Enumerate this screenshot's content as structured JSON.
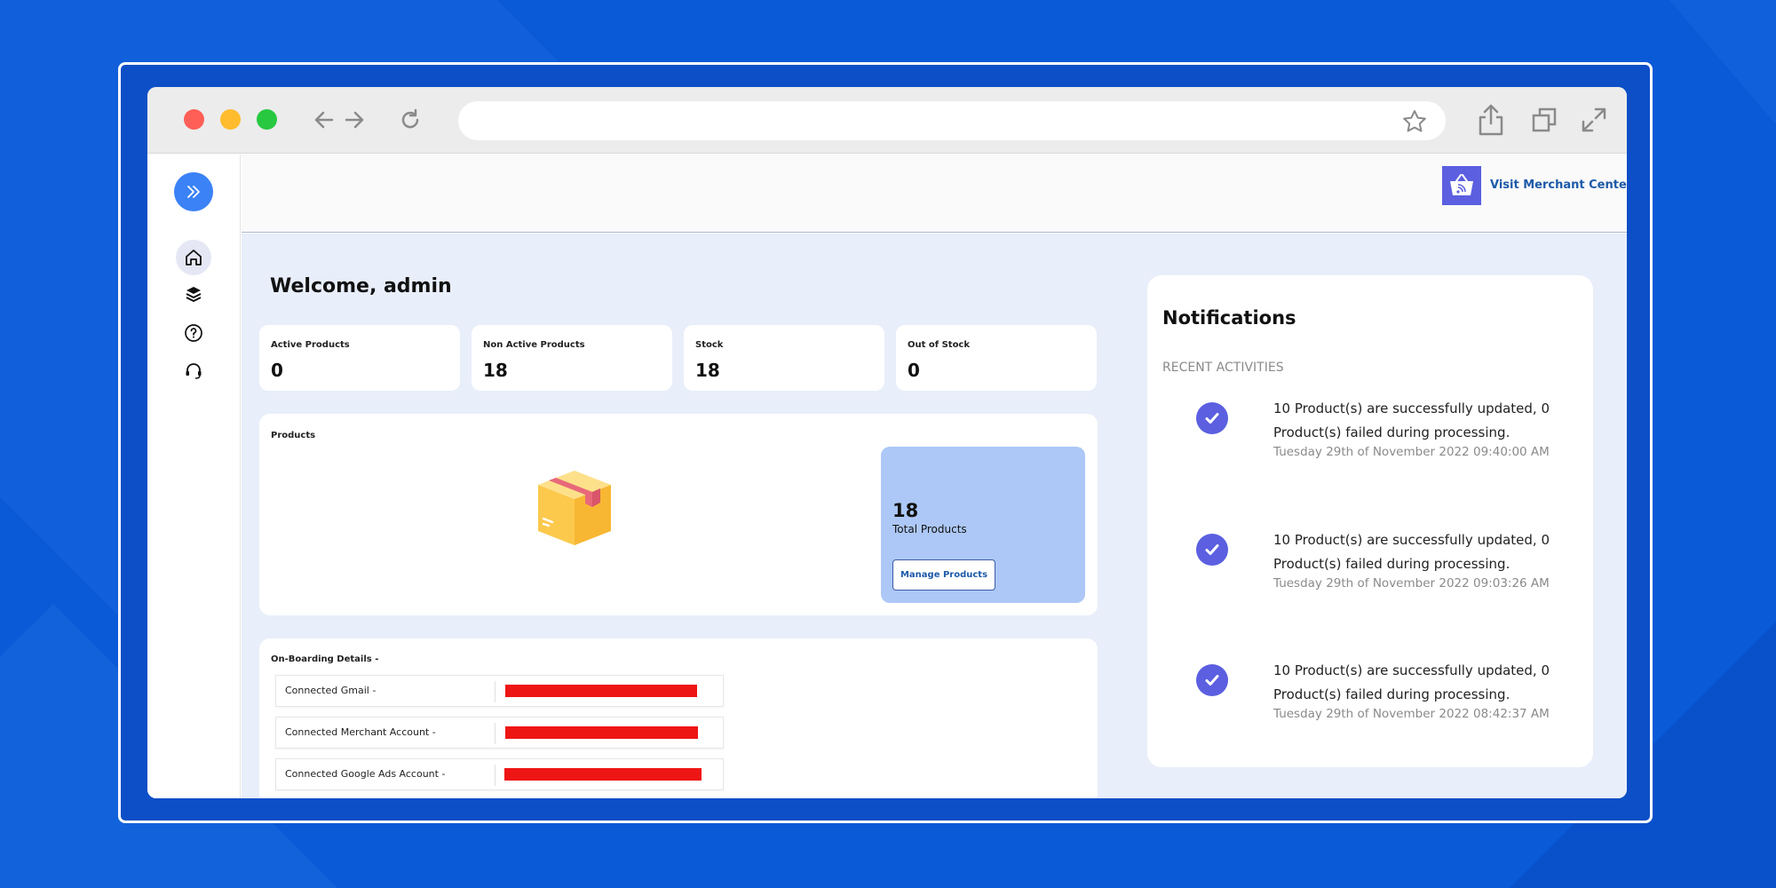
{
  "background": {
    "color": "#0a5ad8"
  },
  "browser": {
    "buttons": {
      "close": "#ff5f57",
      "minimize": "#febc2e",
      "maximize": "#28c840"
    },
    "url": "",
    "icons": [
      "back-arrow-icon",
      "forward-arrow-icon",
      "reload-icon",
      "star-icon",
      "share-icon",
      "tabs-icon",
      "fullscreen-icon"
    ]
  },
  "header": {
    "merchant_link": "Visit Merchant Center",
    "accent": "#5b5fe0"
  },
  "sidebar": {
    "items": [
      {
        "icon": "home-icon",
        "active": true
      },
      {
        "icon": "box-stack-icon",
        "active": false
      },
      {
        "icon": "help-icon",
        "active": false
      },
      {
        "icon": "headset-icon",
        "active": false
      }
    ]
  },
  "main": {
    "welcome": "Welcome, admin",
    "stats": [
      {
        "label": "Active Products",
        "value": "0"
      },
      {
        "label": "Non Active Products",
        "value": "18"
      },
      {
        "label": "Stock",
        "value": "18"
      },
      {
        "label": "Out of Stock",
        "value": "0"
      }
    ],
    "products": {
      "title": "Products",
      "total_value": "18",
      "total_label": "Total Products",
      "manage_button": "Manage Products"
    },
    "onboarding": {
      "title": "On-Boarding Details -",
      "rows": [
        {
          "label": "Connected Gmail -",
          "status_color": "#ee1515"
        },
        {
          "label": "Connected Merchant Account -",
          "status_color": "#ee1515"
        },
        {
          "label": "Connected Google Ads Account -",
          "status_color": "#ee1515"
        }
      ]
    }
  },
  "notifications": {
    "title": "Notifications",
    "subtitle": "RECENT ACTIVITIES",
    "items": [
      {
        "message": "10 Product(s) are successfully updated, 0 Product(s) failed during processing.",
        "time": "Tuesday 29th of November 2022 09:40:00 AM"
      },
      {
        "message": "10 Product(s) are successfully updated, 0 Product(s) failed during processing.",
        "time": "Tuesday 29th of November 2022 09:03:26 AM"
      },
      {
        "message": "10 Product(s) are successfully updated, 0 Product(s) failed during processing.",
        "time": "Tuesday 29th of November 2022 08:42:37 AM"
      }
    ]
  }
}
